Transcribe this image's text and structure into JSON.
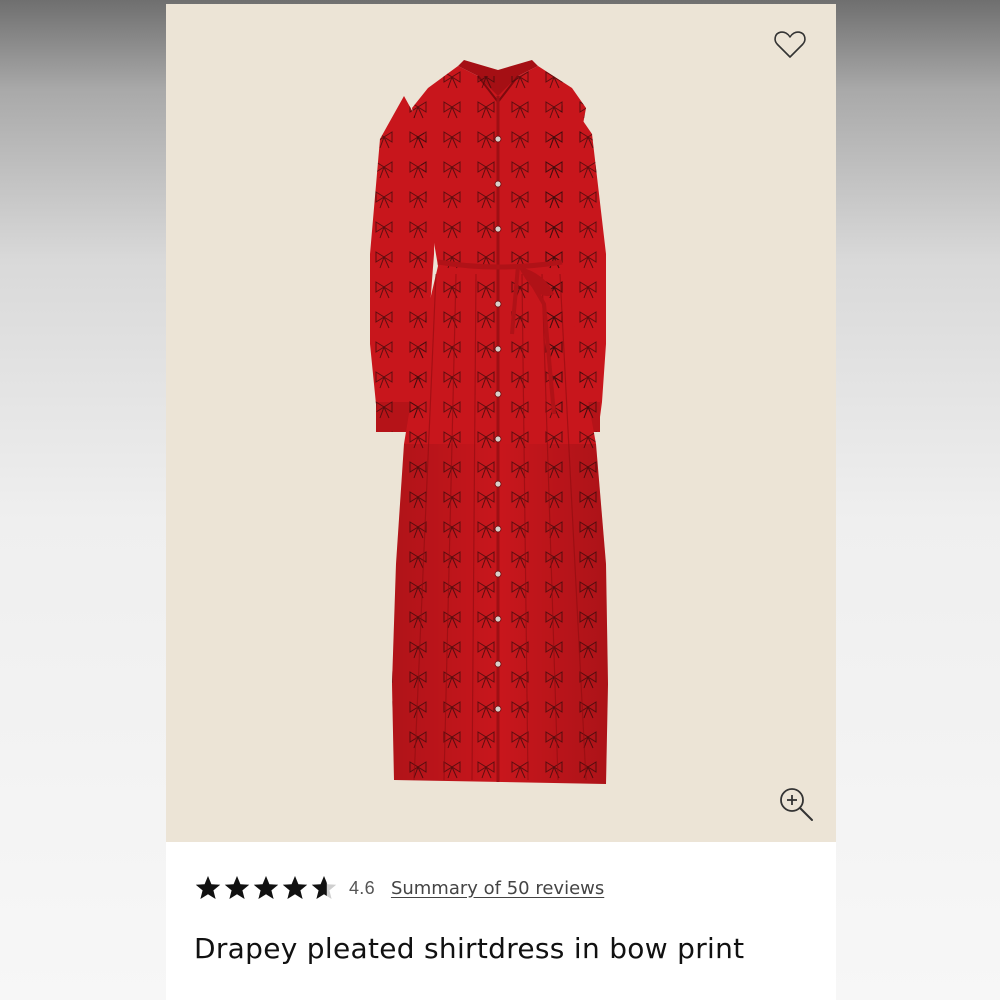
{
  "product": {
    "title": "Drapey pleated shirtdress in bow print",
    "image_alt": "Red long-sleeve pleated maxi shirtdress with black bow print and waist tie",
    "colors": {
      "dress": "#c8161c",
      "dress_shadow": "#9e0f14",
      "print": "#3a0a0a",
      "backdrop": "#ece4d6"
    }
  },
  "rating": {
    "value": "4.6",
    "stars_filled": 4.6,
    "stars_total": 5,
    "summary_link": "Summary of 50 reviews"
  },
  "icons": {
    "wishlist": "heart-outline-icon",
    "zoom": "zoom-in-icon",
    "star": "star-icon"
  }
}
